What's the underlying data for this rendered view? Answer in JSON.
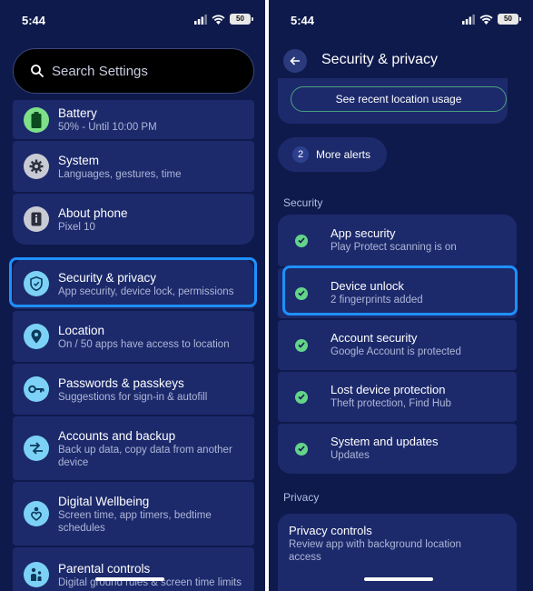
{
  "left": {
    "status": {
      "time": "5:44",
      "battery": "50"
    },
    "search": {
      "placeholder": "Search Settings"
    },
    "items": [
      {
        "title": "Battery",
        "subtitle": "50% - Until 10:00 PM",
        "icon": "battery-icon"
      },
      {
        "title": "System",
        "subtitle": "Languages, gestures, time",
        "icon": "gear-icon"
      },
      {
        "title": "About phone",
        "subtitle": "Pixel 10",
        "icon": "phone-info-icon"
      },
      {
        "title": "Security & privacy",
        "subtitle": "App security, device lock, permissions",
        "icon": "shield-icon"
      },
      {
        "title": "Location",
        "subtitle": "On / 50 apps have access to location",
        "icon": "location-pin-icon"
      },
      {
        "title": "Passwords & passkeys",
        "subtitle": "Suggestions for sign-in & autofill",
        "icon": "key-icon"
      },
      {
        "title": "Accounts and backup",
        "subtitle": "Back up data, copy data from another device",
        "icon": "sync-arrows-icon"
      },
      {
        "title": "Digital Wellbeing",
        "subtitle": "Screen time, app timers, bedtime schedules",
        "icon": "heart-person-icon"
      },
      {
        "title": "Parental controls",
        "subtitle": "Digital ground rules & screen time limits",
        "icon": "family-icon"
      }
    ]
  },
  "right": {
    "status": {
      "time": "5:44",
      "battery": "50"
    },
    "header": {
      "title": "Security & privacy"
    },
    "location_button": "See recent location usage",
    "alerts": {
      "count": "2",
      "label": "More alerts"
    },
    "security_label": "Security",
    "security_items": [
      {
        "title": "App security",
        "subtitle": "Play Protect scanning is on"
      },
      {
        "title": "Device unlock",
        "subtitle": "2 fingerprints added"
      },
      {
        "title": "Account security",
        "subtitle": "Google Account is protected"
      },
      {
        "title": "Lost device protection",
        "subtitle": "Theft protection, Find Hub"
      },
      {
        "title": "System and updates",
        "subtitle": "Updates"
      }
    ],
    "privacy_label": "Privacy",
    "privacy_item": {
      "title": "Privacy controls",
      "subtitle": "Review app with background location access"
    }
  },
  "colors": {
    "background": "#0f1a4c",
    "card": "#1c2a6c",
    "highlight": "#1e90ff",
    "check": "#63d489"
  }
}
